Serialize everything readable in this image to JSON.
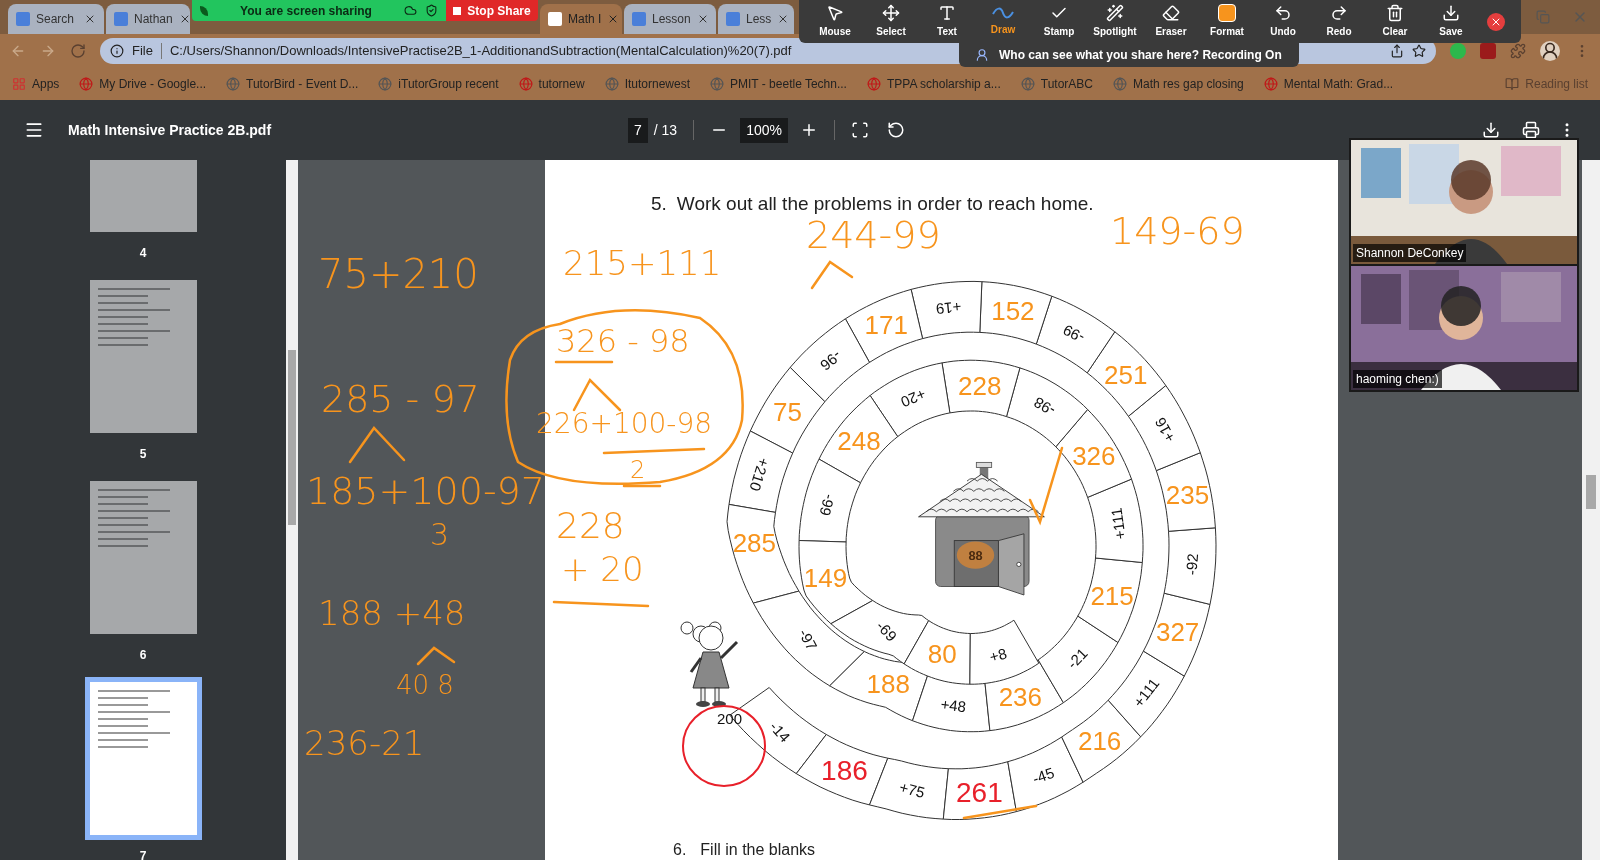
{
  "browser": {
    "tabs": [
      {
        "title": "Search",
        "selected": false
      },
      {
        "title": "Nathan",
        "selected": false
      },
      {
        "title": "Math I",
        "selected": true
      },
      {
        "title": "Lesson",
        "selected": false
      },
      {
        "title": "Less",
        "selected": false
      }
    ],
    "address": {
      "scheme": "File",
      "url": "C:/Users/Shannon/Downloads/IntensivePractise2B_1-AdditionandSubtraction(MentalCalculation)%20(7).pdf"
    },
    "bookmarks": [
      "Apps",
      "My Drive - Google...",
      "TutorBird - Event D...",
      "iTutorGroup recent",
      "tutornew",
      "Itutornewest",
      "PMIT - beetle Techn...",
      "TPPA scholarship a...",
      "TutorABC",
      "Math res gap closing",
      "Mental Math: Grad..."
    ],
    "reading_list": "Reading list"
  },
  "zoom_share": {
    "status": "You are screen sharing",
    "stop": "Stop Share",
    "notice": "Who can see what you share here? Recording On",
    "tools": [
      {
        "label": "Mouse",
        "selected": false
      },
      {
        "label": "Select",
        "selected": false
      },
      {
        "label": "Text",
        "selected": false
      },
      {
        "label": "Draw",
        "selected": true
      },
      {
        "label": "Stamp",
        "selected": false
      },
      {
        "label": "Spotlight",
        "selected": false
      },
      {
        "label": "Eraser",
        "selected": false
      },
      {
        "label": "Format",
        "selected": false
      },
      {
        "label": "Undo",
        "selected": false
      },
      {
        "label": "Redo",
        "selected": false
      },
      {
        "label": "Clear",
        "selected": false
      },
      {
        "label": "Save",
        "selected": false
      }
    ]
  },
  "pdf_viewer": {
    "title": "Math Intensive Practice 2B.pdf",
    "page": "7",
    "page_count": "/ 13",
    "zoom": "100%",
    "thumbnails": [
      {
        "label": "4",
        "selected": false
      },
      {
        "label": "5",
        "selected": false
      },
      {
        "label": "6",
        "selected": false
      },
      {
        "label": "7",
        "selected": true
      }
    ]
  },
  "page": {
    "question": "5.",
    "instruction": "Work out all the problems in order to reach home.",
    "start": "200",
    "home": "88",
    "cells": [
      {
        "text": "-14",
        "kind": "printed"
      },
      {
        "text": "186",
        "kind": "red_ink"
      },
      {
        "text": "+75",
        "kind": "printed"
      },
      {
        "text": "261",
        "kind": "red_ink"
      },
      {
        "text": "-45",
        "kind": "printed"
      },
      {
        "text": "216",
        "kind": "orange_ink"
      },
      {
        "text": "+111",
        "kind": "printed"
      },
      {
        "text": "327",
        "kind": "orange_ink"
      },
      {
        "text": "-92",
        "kind": "printed"
      },
      {
        "text": "235",
        "kind": "orange_ink"
      },
      {
        "text": "+16",
        "kind": "printed"
      },
      {
        "text": "251",
        "kind": "orange_ink"
      },
      {
        "text": "-99",
        "kind": "printed"
      },
      {
        "text": "152",
        "kind": "orange_ink"
      },
      {
        "text": "+19",
        "kind": "printed"
      },
      {
        "text": "171",
        "kind": "orange_ink"
      },
      {
        "text": "-96",
        "kind": "printed"
      },
      {
        "text": "75",
        "kind": "orange_ink"
      },
      {
        "text": "+210",
        "kind": "printed"
      },
      {
        "text": "285",
        "kind": "orange_ink"
      },
      {
        "text": "-97",
        "kind": "printed"
      },
      {
        "text": "188",
        "kind": "orange_ink"
      },
      {
        "text": "+48",
        "kind": "printed"
      },
      {
        "text": "236",
        "kind": "orange_ink"
      },
      {
        "text": "-21",
        "kind": "printed"
      },
      {
        "text": "215",
        "kind": "orange_ink"
      },
      {
        "text": "+111",
        "kind": "printed"
      },
      {
        "text": "326",
        "kind": "orange_ink"
      },
      {
        "text": "-98",
        "kind": "printed"
      },
      {
        "text": "228",
        "kind": "orange_ink"
      },
      {
        "text": "+20",
        "kind": "printed"
      },
      {
        "text": "248",
        "kind": "orange_ink"
      },
      {
        "text": "-99",
        "kind": "printed"
      },
      {
        "text": "149",
        "kind": "orange_ink"
      },
      {
        "text": "-69",
        "kind": "printed"
      },
      {
        "text": "80",
        "kind": "orange_ink"
      },
      {
        "text": "+8",
        "kind": "printed"
      }
    ],
    "next_number": "6.",
    "next_instruction": "Fill in the blanks"
  },
  "annotations": [
    {
      "text": "75+210"
    },
    {
      "text": "285 - 97"
    },
    {
      "text": "185+100-97"
    },
    {
      "text": "3"
    },
    {
      "text": "188 +48"
    },
    {
      "text": "40 8"
    },
    {
      "text": "236-21"
    },
    {
      "text": "215+111"
    },
    {
      "text": "244-99"
    },
    {
      "text": "149-69"
    },
    {
      "text": "326 - 98"
    },
    {
      "text": "226+100-98"
    },
    {
      "text": "2"
    },
    {
      "text": "228"
    },
    {
      "text": "+ 20"
    }
  ],
  "video_panel": [
    {
      "name": "Shannon DeConkey"
    },
    {
      "name": "haoming chen:)"
    }
  ]
}
